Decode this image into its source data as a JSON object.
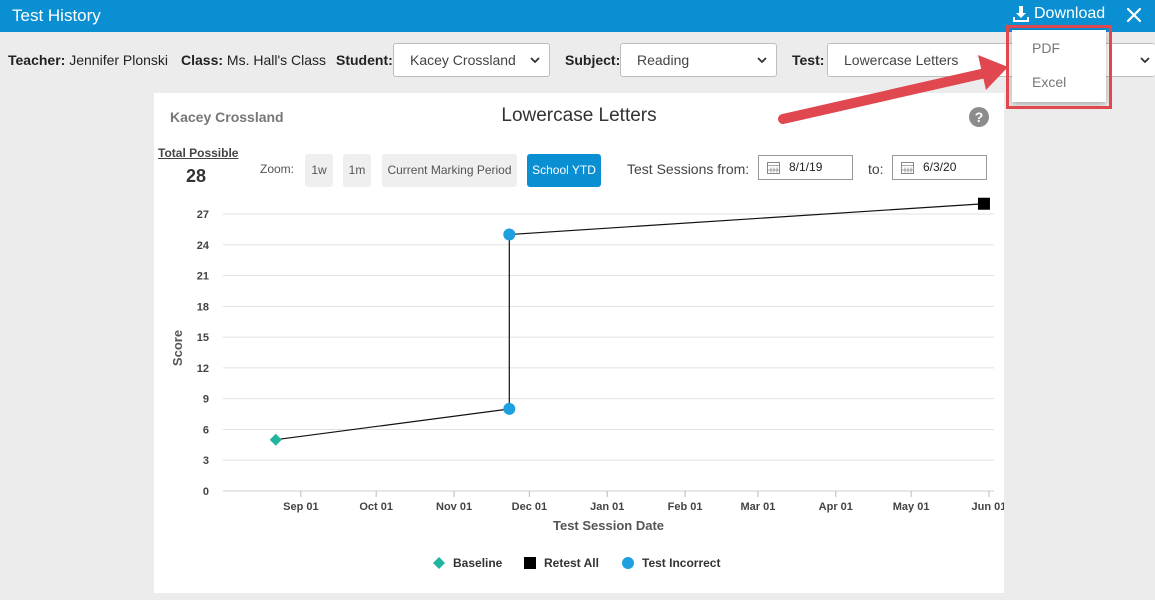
{
  "window": {
    "title": "Test History",
    "download_label": "Download",
    "download_icon": "download-icon",
    "close_icon": "close-icon",
    "brand_color": "#0b8fd3"
  },
  "filters": {
    "teacher_label": "Teacher:",
    "teacher_value": "Jennifer Plonski",
    "class_label": "Class:",
    "class_value": "Ms. Hall's Class",
    "student_label": "Student:",
    "student_value": "Kacey Crossland",
    "subject_label": "Subject:",
    "subject_value": "Reading",
    "test_label": "Test:",
    "test_value": "Lowercase Letters"
  },
  "download_menu": {
    "options": [
      "PDF",
      "Excel"
    ],
    "highlight_color": "#e0474f"
  },
  "card": {
    "student_name": "Kacey Crossland",
    "title": "Lowercase Letters",
    "help_label": "?",
    "total_possible_label": "Total Possible",
    "total_possible_value": "28",
    "zoom_label": "Zoom:",
    "zoom_buttons": [
      "1w",
      "1m",
      "Current Marking Period",
      "School YTD"
    ],
    "zoom_active": "School YTD",
    "sessions_from_label": "Test Sessions from:",
    "date_from": "8/1/19",
    "to_label": "to:",
    "date_to": "6/3/20"
  },
  "chart_data": {
    "type": "line",
    "xlabel": "Test Session Date",
    "ylabel": "Score",
    "ylim": [
      0,
      27
    ],
    "yticks": [
      0,
      3,
      6,
      9,
      12,
      15,
      18,
      21,
      24,
      27
    ],
    "xlim": [
      "2019-08-01",
      "2020-06-03"
    ],
    "xticks": [
      {
        "date": "2019-09-01",
        "label": "Sep 01"
      },
      {
        "date": "2019-10-01",
        "label": "Oct 01"
      },
      {
        "date": "2019-11-01",
        "label": "Nov 01"
      },
      {
        "date": "2019-12-01",
        "label": "Dec 01"
      },
      {
        "date": "2020-01-01",
        "label": "Jan 01"
      },
      {
        "date": "2020-02-01",
        "label": "Feb 01"
      },
      {
        "date": "2020-03-01",
        "label": "Mar 01"
      },
      {
        "date": "2020-04-01",
        "label": "Apr 01"
      },
      {
        "date": "2020-05-01",
        "label": "May 01"
      },
      {
        "date": "2020-06-01",
        "label": "Jun 01"
      }
    ],
    "grid": true,
    "legend_position": "bottom",
    "series": [
      {
        "name": "Baseline",
        "marker": "diamond",
        "color": "#21b5a0",
        "points": [
          {
            "x": "2019-08-22",
            "y": 5
          }
        ]
      },
      {
        "name": "Retest All",
        "marker": "square",
        "color": "#000000",
        "points": [
          {
            "x": "2020-05-30",
            "y": 28
          }
        ]
      },
      {
        "name": "Test Incorrect",
        "marker": "circle",
        "color": "#1ea0e0",
        "points": [
          {
            "x": "2019-11-23",
            "y": 8
          },
          {
            "x": "2019-11-23",
            "y": 25
          }
        ]
      }
    ],
    "connected_line": [
      {
        "x": "2019-08-22",
        "y": 5
      },
      {
        "x": "2019-11-23",
        "y": 8
      },
      {
        "x": "2019-11-23",
        "y": 25
      },
      {
        "x": "2020-05-30",
        "y": 28
      }
    ]
  }
}
